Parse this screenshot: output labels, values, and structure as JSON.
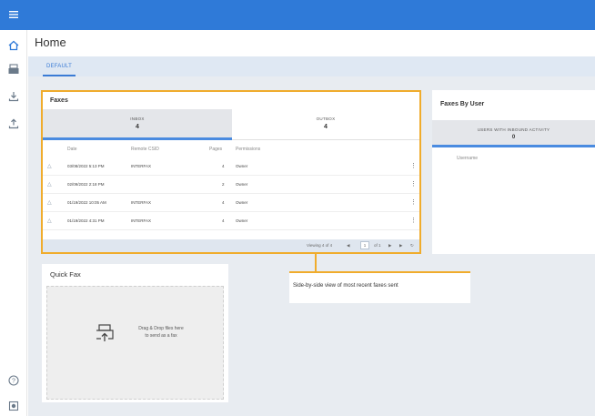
{
  "topbar": {
    "menu_icon": "hamburger-icon",
    "color": "#2f7ad8"
  },
  "sidebar": {
    "items": [
      {
        "icon": "home-icon",
        "active": true
      },
      {
        "icon": "fax-machine-icon"
      },
      {
        "icon": "download-icon"
      },
      {
        "icon": "upload-icon"
      }
    ],
    "bottom_items": [
      {
        "icon": "help-icon"
      },
      {
        "icon": "settings-icon"
      }
    ]
  },
  "page": {
    "title": "Home"
  },
  "tabs": [
    {
      "label": "DEFAULT",
      "active": true
    }
  ],
  "faxes": {
    "title": "Faxes",
    "inbox": {
      "label": "INBOX",
      "count": "4"
    },
    "outbox": {
      "label": "OUTBOX",
      "count": "4"
    },
    "columns": [
      "Date",
      "Remote CSID",
      "Pages",
      "Permissions"
    ],
    "rows": [
      {
        "date": "03/08/2022 5:13 PM",
        "csid": "INTERFAX",
        "pages": "4",
        "permissions": "Owner"
      },
      {
        "date": "02/09/2022 2:18 PM",
        "csid": "",
        "pages": "2",
        "permissions": "Owner"
      },
      {
        "date": "01/19/2022 10:05 AM",
        "csid": "INTERFAX",
        "pages": "4",
        "permissions": "Owner"
      },
      {
        "date": "01/19/2022 4:31 PM",
        "csid": "INTERFAX",
        "pages": "4",
        "permissions": "Owner"
      }
    ],
    "pager": {
      "viewing": "Viewing 4 of 4",
      "page": "1",
      "of": "of 1"
    }
  },
  "faxes_by_user": {
    "title": "Faxes By User",
    "header": {
      "label": "USERS WITH INBOUND ACTIVITY",
      "count": "0"
    },
    "column": "Username"
  },
  "quick_fax": {
    "title": "Quick Fax",
    "drop_text_1": "Drag & Drop files here",
    "drop_text_2": "to send as a fax"
  },
  "callout": {
    "text": "Side-by-side view of most recent faxes sent",
    "color": "#f0ac2c"
  }
}
